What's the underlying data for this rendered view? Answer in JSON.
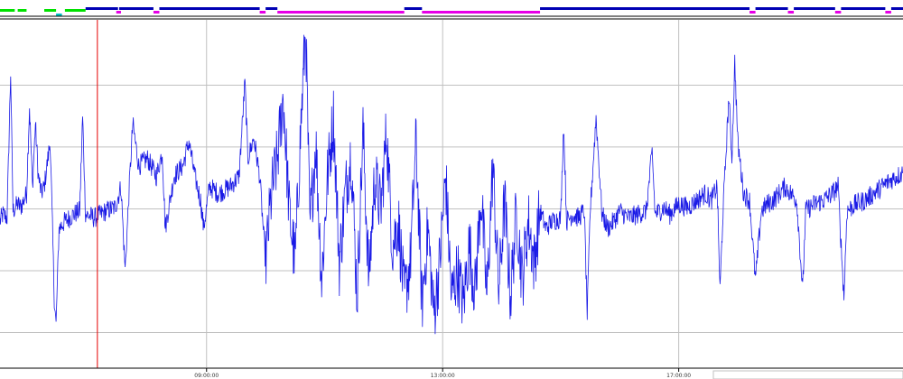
{
  "chart_data": {
    "type": "line",
    "title": "",
    "xlabel": "",
    "ylabel": "",
    "grid": true,
    "x_ticks": [
      {
        "label": "09:00:00",
        "hour": 9
      },
      {
        "label": "13:00:00",
        "hour": 13
      },
      {
        "label": "17:00:00",
        "hour": 17
      }
    ],
    "xlim_hours": [
      5.5,
      20.8
    ],
    "ylim": [
      0,
      100
    ],
    "cursor_hour": 7.15,
    "colors": {
      "series": "#1a1ae6",
      "cursor": "#e60000",
      "grid": "#c0c0c0",
      "axis": "#000000",
      "stage_wake": "#00e000",
      "stage_wake_light": "#00c0c0",
      "stage_sleep": "#0000b4",
      "stage_rem": "#e600e6"
    },
    "stage_bar": [
      {
        "stage": "wake",
        "start": 5.5,
        "end": 5.75
      },
      {
        "stage": "wake",
        "start": 5.8,
        "end": 5.95
      },
      {
        "stage": "wake",
        "start": 6.25,
        "end": 6.45
      },
      {
        "stage": "wake_light",
        "start": 6.45,
        "end": 6.55
      },
      {
        "stage": "wake",
        "start": 6.6,
        "end": 6.95
      },
      {
        "stage": "sleep",
        "start": 6.95,
        "end": 7.5
      },
      {
        "stage": "sleep",
        "start": 7.52,
        "end": 8.1
      },
      {
        "stage": "rem",
        "start": 7.47,
        "end": 7.55
      },
      {
        "stage": "sleep",
        "start": 8.15,
        "end": 8.05
      },
      {
        "stage": "sleep",
        "start": 8.2,
        "end": 9.9
      },
      {
        "stage": "rem",
        "start": 8.1,
        "end": 8.2
      },
      {
        "stage": "rem",
        "start": 9.9,
        "end": 10.0
      },
      {
        "stage": "rem",
        "start": 10.2,
        "end": 12.35
      },
      {
        "stage": "sleep",
        "start": 10.0,
        "end": 10.2
      },
      {
        "stage": "sleep",
        "start": 12.35,
        "end": 12.65
      },
      {
        "stage": "rem",
        "start": 12.65,
        "end": 14.65
      },
      {
        "stage": "sleep",
        "start": 14.65,
        "end": 18.2
      },
      {
        "stage": "rem",
        "start": 18.2,
        "end": 18.3
      },
      {
        "stage": "sleep",
        "start": 18.3,
        "end": 18.85
      },
      {
        "stage": "rem",
        "start": 18.85,
        "end": 18.95
      },
      {
        "stage": "sleep",
        "start": 18.95,
        "end": 19.65
      },
      {
        "stage": "rem",
        "start": 19.65,
        "end": 19.75
      },
      {
        "stage": "sleep",
        "start": 19.75,
        "end": 20.5
      },
      {
        "stage": "rem",
        "start": 20.5,
        "end": 20.6
      },
      {
        "stage": "sleep",
        "start": 20.6,
        "end": 20.8
      }
    ],
    "series": [
      {
        "values_keypoints": [
          [
            5.5,
            42
          ],
          [
            5.55,
            44
          ],
          [
            5.62,
            43
          ],
          [
            5.68,
            85
          ],
          [
            5.72,
            45
          ],
          [
            5.8,
            47
          ],
          [
            5.85,
            46
          ],
          [
            5.95,
            50
          ],
          [
            6.0,
            75
          ],
          [
            6.05,
            52
          ],
          [
            6.1,
            70
          ],
          [
            6.15,
            55
          ],
          [
            6.2,
            50
          ],
          [
            6.25,
            52
          ],
          [
            6.35,
            65
          ],
          [
            6.42,
            20
          ],
          [
            6.45,
            12
          ],
          [
            6.5,
            40
          ],
          [
            6.6,
            42
          ],
          [
            6.75,
            44
          ],
          [
            6.85,
            45
          ],
          [
            6.9,
            72
          ],
          [
            6.95,
            44
          ],
          [
            7.1,
            43
          ],
          [
            7.3,
            45
          ],
          [
            7.45,
            46
          ],
          [
            7.55,
            52
          ],
          [
            7.62,
            28
          ],
          [
            7.7,
            55
          ],
          [
            7.75,
            70
          ],
          [
            7.85,
            58
          ],
          [
            8.0,
            60
          ],
          [
            8.15,
            55
          ],
          [
            8.25,
            62
          ],
          [
            8.3,
            40
          ],
          [
            8.45,
            55
          ],
          [
            8.6,
            58
          ],
          [
            8.7,
            65
          ],
          [
            8.8,
            55
          ],
          [
            8.9,
            48
          ],
          [
            8.95,
            40
          ],
          [
            9.05,
            52
          ],
          [
            9.2,
            50
          ],
          [
            9.4,
            52
          ],
          [
            9.55,
            55
          ],
          [
            9.65,
            82
          ],
          [
            9.7,
            60
          ],
          [
            9.8,
            66
          ],
          [
            9.9,
            55
          ],
          [
            10.0,
            30
          ],
          [
            10.1,
            50
          ],
          [
            10.2,
            60
          ],
          [
            10.3,
            78
          ],
          [
            10.4,
            45
          ],
          [
            10.5,
            30
          ],
          [
            10.6,
            70
          ],
          [
            10.68,
            98
          ],
          [
            10.75,
            40
          ],
          [
            10.85,
            65
          ],
          [
            10.95,
            25
          ],
          [
            11.05,
            55
          ],
          [
            11.15,
            72
          ],
          [
            11.25,
            30
          ],
          [
            11.35,
            50
          ],
          [
            11.45,
            62
          ],
          [
            11.55,
            20
          ],
          [
            11.65,
            68
          ],
          [
            11.75,
            25
          ],
          [
            11.85,
            55
          ],
          [
            11.95,
            45
          ],
          [
            12.05,
            68
          ],
          [
            12.15,
            35
          ],
          [
            12.25,
            42
          ],
          [
            12.35,
            20
          ],
          [
            12.45,
            30
          ],
          [
            12.55,
            65
          ],
          [
            12.65,
            18
          ],
          [
            12.75,
            40
          ],
          [
            12.85,
            15
          ],
          [
            12.95,
            30
          ],
          [
            13.05,
            55
          ],
          [
            13.15,
            20
          ],
          [
            13.25,
            28
          ],
          [
            13.35,
            18
          ],
          [
            13.45,
            35
          ],
          [
            13.55,
            22
          ],
          [
            13.65,
            50
          ],
          [
            13.75,
            20
          ],
          [
            13.85,
            58
          ],
          [
            13.95,
            22
          ],
          [
            14.05,
            48
          ],
          [
            14.15,
            20
          ],
          [
            14.25,
            45
          ],
          [
            14.35,
            25
          ],
          [
            14.45,
            42
          ],
          [
            14.55,
            30
          ],
          [
            14.65,
            45
          ],
          [
            14.75,
            40
          ],
          [
            14.85,
            42
          ],
          [
            15.0,
            43
          ],
          [
            15.05,
            70
          ],
          [
            15.1,
            42
          ],
          [
            15.2,
            44
          ],
          [
            15.3,
            43
          ],
          [
            15.4,
            45
          ],
          [
            15.45,
            15
          ],
          [
            15.5,
            45
          ],
          [
            15.6,
            72
          ],
          [
            15.7,
            44
          ],
          [
            15.8,
            40
          ],
          [
            15.9,
            42
          ],
          [
            16.0,
            45
          ],
          [
            16.15,
            43
          ],
          [
            16.3,
            44
          ],
          [
            16.45,
            45
          ],
          [
            16.55,
            62
          ],
          [
            16.6,
            44
          ],
          [
            16.75,
            46
          ],
          [
            16.85,
            44
          ],
          [
            17.0,
            47
          ],
          [
            17.15,
            46
          ],
          [
            17.3,
            48
          ],
          [
            17.45,
            50
          ],
          [
            17.55,
            48
          ],
          [
            17.65,
            52
          ],
          [
            17.7,
            22
          ],
          [
            17.75,
            45
          ],
          [
            17.85,
            78
          ],
          [
            17.9,
            60
          ],
          [
            17.95,
            88
          ],
          [
            18.0,
            65
          ],
          [
            18.1,
            50
          ],
          [
            18.2,
            48
          ],
          [
            18.3,
            25
          ],
          [
            18.4,
            45
          ],
          [
            18.5,
            47
          ],
          [
            18.6,
            48
          ],
          [
            18.7,
            50
          ],
          [
            18.8,
            52
          ],
          [
            18.9,
            50
          ],
          [
            19.0,
            48
          ],
          [
            19.1,
            22
          ],
          [
            19.15,
            45
          ],
          [
            19.3,
            47
          ],
          [
            19.45,
            48
          ],
          [
            19.6,
            50
          ],
          [
            19.7,
            52
          ],
          [
            19.8,
            20
          ],
          [
            19.85,
            45
          ],
          [
            20.0,
            47
          ],
          [
            20.15,
            48
          ],
          [
            20.3,
            50
          ],
          [
            20.45,
            52
          ],
          [
            20.6,
            54
          ],
          [
            20.8,
            56
          ]
        ]
      }
    ]
  }
}
